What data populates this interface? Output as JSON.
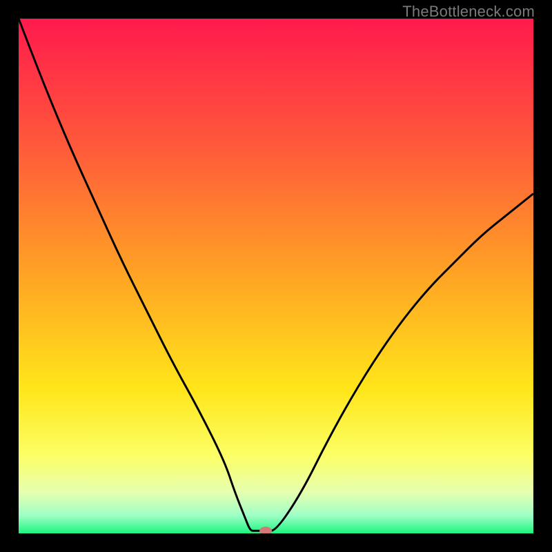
{
  "watermark": "TheBottleneck.com",
  "chart_data": {
    "type": "line",
    "title": "",
    "xlabel": "",
    "ylabel": "",
    "xlim": [
      0,
      100
    ],
    "ylim": [
      0,
      100
    ],
    "grid": false,
    "series": [
      {
        "name": "bottleneck-curve",
        "x": [
          0,
          5,
          10,
          15,
          20,
          25,
          30,
          35,
          40,
          42,
          44,
          45,
          46,
          48,
          50,
          55,
          60,
          65,
          70,
          75,
          80,
          85,
          90,
          95,
          100
        ],
        "values": [
          100,
          87,
          75,
          64,
          53,
          43,
          33,
          24,
          14,
          8,
          3,
          0.5,
          0.5,
          0.5,
          0.5,
          8,
          18,
          27,
          35,
          42,
          48,
          53,
          58,
          62,
          66
        ]
      }
    ],
    "marker": {
      "x": 48,
      "y": 0.5,
      "color": "#d07a78"
    },
    "gradient_stops": [
      {
        "offset": 0.0,
        "color": "#ff1a4d"
      },
      {
        "offset": 0.25,
        "color": "#ff5a3a"
      },
      {
        "offset": 0.5,
        "color": "#ffa424"
      },
      {
        "offset": 0.72,
        "color": "#ffe61a"
      },
      {
        "offset": 0.85,
        "color": "#fcff66"
      },
      {
        "offset": 0.92,
        "color": "#e6ffb0"
      },
      {
        "offset": 0.965,
        "color": "#9fffc6"
      },
      {
        "offset": 1.0,
        "color": "#1df57e"
      }
    ]
  }
}
